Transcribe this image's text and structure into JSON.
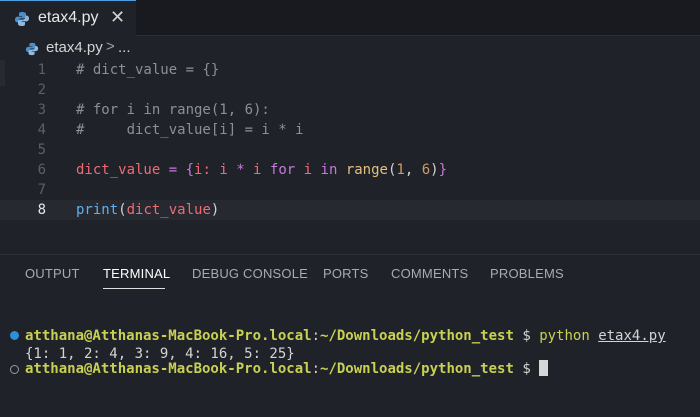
{
  "tabbar": {
    "tab_label": "etax4.py",
    "close_glyph": "✕"
  },
  "breadcrumb": {
    "file": "etax4.py",
    "separator": ">",
    "more": "..."
  },
  "editor": {
    "line_numbers": [
      "1",
      "2",
      "3",
      "4",
      "5",
      "6",
      "7",
      "8"
    ],
    "active_line": "8",
    "lines": {
      "l1": "# dict_value = {}",
      "l3": "# for i in range(1, 6):",
      "l4": "#     dict_value[i] = i * i",
      "l6": {
        "var": "dict_value",
        "eq": " = ",
        "lbrace": "{",
        "i1": "i: i ",
        "star": "*",
        "i2": " i ",
        "for": "for",
        "i3": " i ",
        "in": "in",
        "sp": " ",
        "range": "range",
        "lpar": "(",
        "n1": "1",
        "comma": ", ",
        "n2": "6",
        "rpar": ")",
        "rbrace": "}"
      },
      "l8": {
        "print": "print",
        "lpar": "(",
        "arg": "dict_value",
        "rpar": ")"
      }
    }
  },
  "panel": {
    "tabs": [
      "OUTPUT",
      "TERMINAL",
      "DEBUG CONSOLE",
      "PORTS",
      "COMMENTS",
      "PROBLEMS"
    ],
    "active_tab": "TERMINAL"
  },
  "terminal": {
    "user_host": "atthana@Atthanas-MacBook-Pro.local",
    "colon": ":",
    "path": "~/Downloads/python_test",
    "prompt": " $ ",
    "command": "python ",
    "command_file": "etax4.py",
    "output": "{1: 1, 2: 4, 3: 9, 4: 16, 5: 25}"
  },
  "colors": {
    "accent_blue": "#2f8fd4",
    "terminal_green": "#c9d153",
    "variable_red": "#ef6b73",
    "keyword_purple": "#c678dd",
    "number_orange": "#d19a66",
    "function_blue": "#61afef",
    "builtin_yellow": "#e5c07b"
  }
}
